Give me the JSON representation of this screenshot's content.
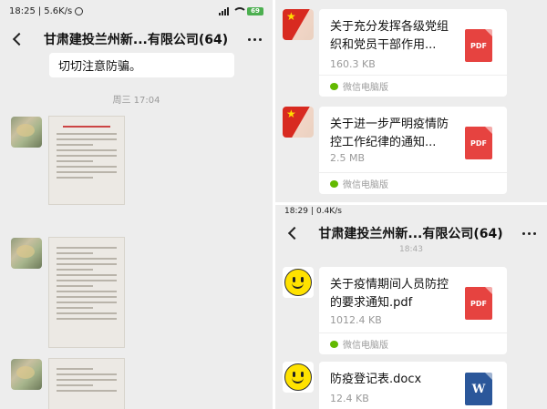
{
  "left_panel": {
    "status": {
      "time": "18:25",
      "speed": "5.6K/s",
      "battery": "69"
    },
    "header": {
      "title": "甘肃建投兰州新...有限公司(64)"
    },
    "message_text": "切切注意防骗。",
    "timestamp": "周三 17:04",
    "images": [
      {
        "kind": "document-photo"
      },
      {
        "kind": "document-photo"
      },
      {
        "kind": "document-photo"
      }
    ]
  },
  "right_top": {
    "files": [
      {
        "name": "关于充分发挥各级党组织和党员干部作用...",
        "size": "160.3 KB",
        "type": "PDF",
        "source": "微信电脑版"
      },
      {
        "name": "关于进一步严明疫情防控工作纪律的通知...",
        "size": "2.5 MB",
        "type": "PDF",
        "source": "微信电脑版"
      }
    ]
  },
  "right_bottom": {
    "status": {
      "time": "18:29",
      "speed": "0.4K/s"
    },
    "header": {
      "title": "甘肃建投兰州新...有限公司(64)"
    },
    "partial_time": "18:43",
    "files": [
      {
        "name": "关于疫情期间人员防控的要求通知.pdf",
        "size": "1012.4 KB",
        "type": "PDF",
        "source": "微信电脑版"
      },
      {
        "name": "防疫登记表.docx",
        "size": "12.4 KB",
        "type": "W"
      }
    ]
  },
  "colors": {
    "chat_bg": "#ededed",
    "pdf_red": "#e64340",
    "word_blue": "#2b579a",
    "wechat_green": "#62b900"
  }
}
